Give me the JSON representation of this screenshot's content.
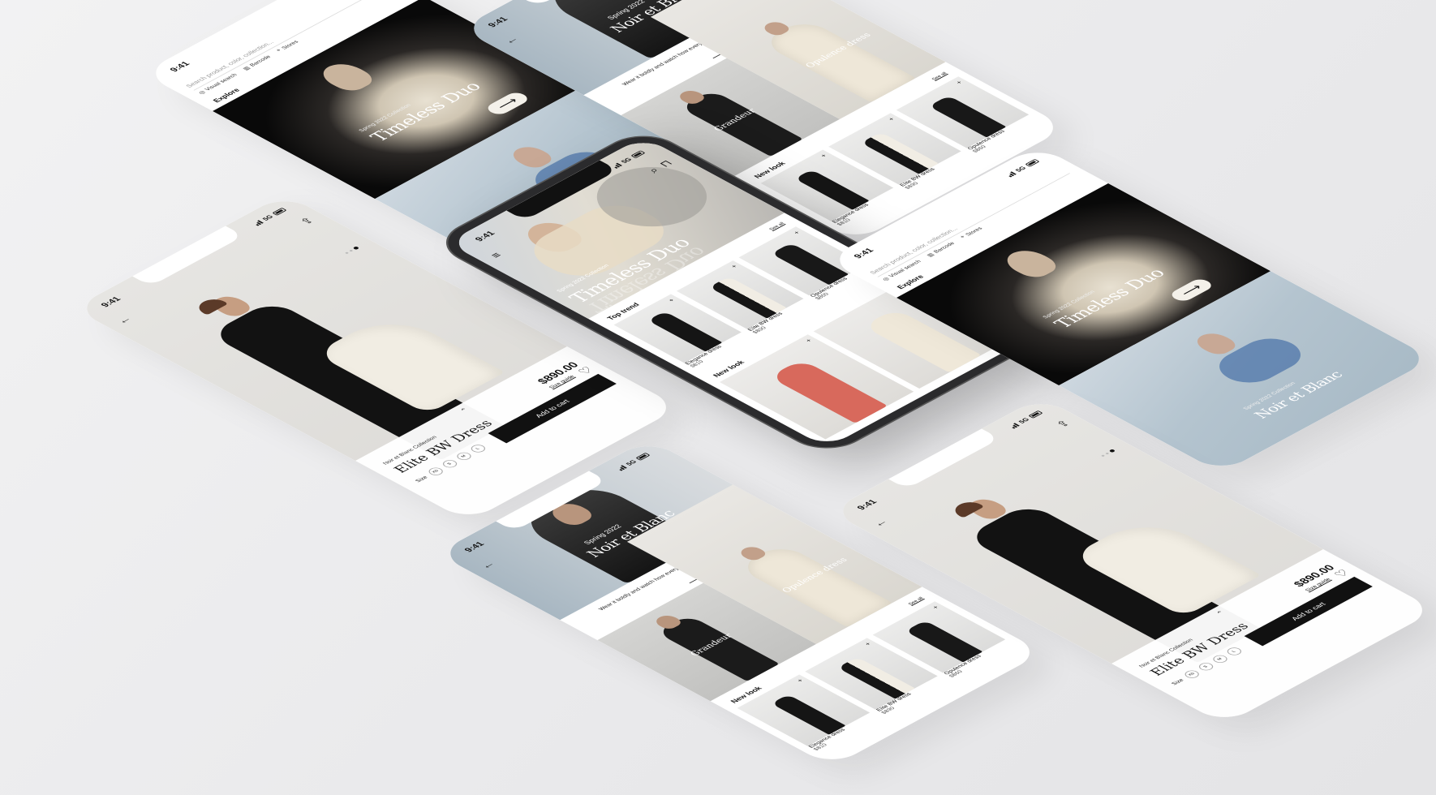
{
  "status": {
    "time": "9:41",
    "network": "5G"
  },
  "explore": {
    "search_placeholder": "Search product, color, collection...",
    "chip_visual": "Visual search",
    "chip_barcode": "Barcode",
    "chip_stores": "Stores",
    "section": "Explore",
    "hero1_sub": "Spring 2022 Collection",
    "hero1_title": "Timeless Duo",
    "hero2_sub": "Spring 2022 Collection",
    "hero2_title": "Noir et Blanc"
  },
  "collection": {
    "season": "Spring 2022",
    "title": "Noir et Blanc",
    "quote": "Wear it boldly and watch how everything else falls perfectly into place.",
    "card1": "Grandeur",
    "card2": "Opulence dress",
    "section": "New look",
    "see_all": "See all",
    "items": [
      {
        "name": "Elegance dress",
        "price": "$810"
      },
      {
        "name": "Elite BW dress",
        "price": "$890"
      },
      {
        "name": "Opulence dress",
        "price": "$860"
      }
    ]
  },
  "product": {
    "collection": "Noir et Blanc Collection",
    "name": "Elite BW Dress",
    "price": "$890.00",
    "size_guide": "Size guide",
    "size_label": "Size",
    "sizes": [
      "XS",
      "S",
      "M",
      "L"
    ],
    "cart": "Add to cart"
  },
  "home": {
    "hero_sub": "Spring 2022 Collection",
    "hero_title": "Timeless Duo",
    "top_trend": "Top trend",
    "see_all": "See all",
    "items": [
      {
        "name": "Elegance dress",
        "price": "$810"
      },
      {
        "name": "Elite BW dress",
        "price": "$890"
      },
      {
        "name": "Opulence dress",
        "price": "$860"
      }
    ],
    "new_look": "New look"
  }
}
